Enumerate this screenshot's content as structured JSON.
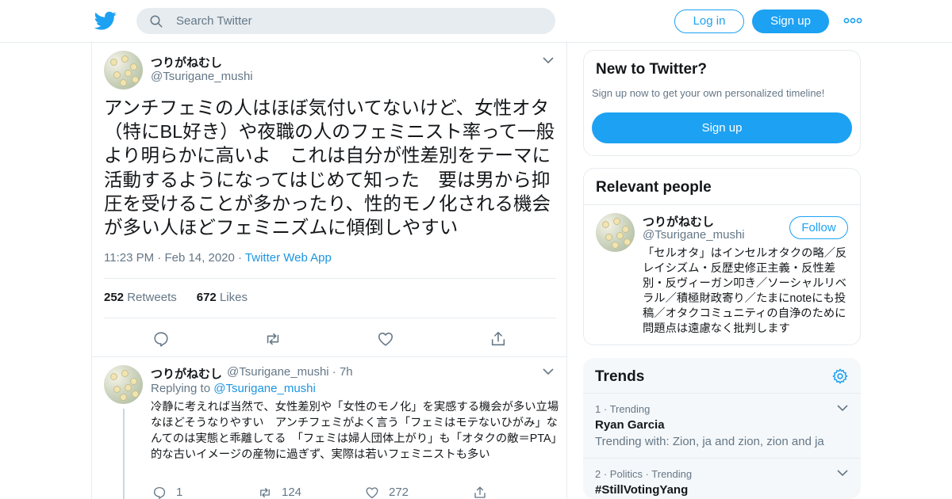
{
  "header": {
    "search_placeholder": "Search Twitter",
    "login_label": "Log in",
    "signup_label": "Sign up",
    "logo_icon": "twitter-bird-icon",
    "more_icon": "more-dots-icon"
  },
  "tweet": {
    "author_name": "つりがねむし",
    "author_handle": "@Tsurigane_mushi",
    "text": "アンチフェミの人はほぼ気付いてないけど、女性オタ（特にBL好き）や夜職の人のフェミニスト率って一般より明らかに高いよ　これは自分が性差別をテーマに活動するようになってはじめて知った　要は男から抑圧を受けることが多かったり、性的モノ化される機会が多い人ほどフェミニズムに傾倒しやすい",
    "time": "11:23 PM",
    "date": "Feb 14, 2020",
    "source": "Twitter Web App",
    "retweets_count": "252",
    "retweets_label": "Retweets",
    "likes_count": "672",
    "likes_label": "Likes"
  },
  "reply": {
    "author_name": "つりがねむし",
    "author_handle": "@Tsurigane_mushi",
    "age": "7h",
    "replying_label": "Replying to",
    "replying_to": "@Tsurigane_mushi",
    "text": "冷静に考えれば当然で、女性差別や「女性のモノ化」を実感する機会が多い立場なほどそうなりやすい　アンチフェミがよく言う「フェミはモテないひがみ」なんてのは実態と乖離してる　「フェミは婦人団体上がり」も「オタクの敵＝PTA」的な古いイメージの産物に過ぎず、実際は若いフェミニストも多い",
    "reply_count": "1",
    "retweet_count": "124",
    "like_count": "272"
  },
  "new_to_twitter": {
    "title": "New to Twitter?",
    "subtitle": "Sign up now to get your own personalized timeline!",
    "button": "Sign up"
  },
  "relevant_people": {
    "title": "Relevant people",
    "name": "つりがねむし",
    "handle": "@Tsurigane_mushi",
    "follow_label": "Follow",
    "bio": "「セルオタ」はインセルオタクの略／反レイシズム・反歴史修正主義・反性差別・反ヴィーガン叩き／ソーシャルリベラル／積極財政寄り／たまにnoteにも投稿／オタクコミュニティの自浄のために問題点は遠慮なく批判します"
  },
  "trends": {
    "title": "Trends",
    "items": [
      {
        "rank": "1",
        "context": "Trending",
        "name": "Ryan Garcia",
        "with": "Trending with: Zion, ja and zion, zion and ja"
      },
      {
        "rank": "2",
        "context": "Politics · Trending",
        "name": "#StillVotingYang",
        "with": ""
      }
    ]
  },
  "colors": {
    "brand_blue": "#1da1f2",
    "link_blue": "#1b95e0",
    "text_primary": "#14171a",
    "text_secondary": "#657786",
    "border": "#e6ecf0"
  }
}
